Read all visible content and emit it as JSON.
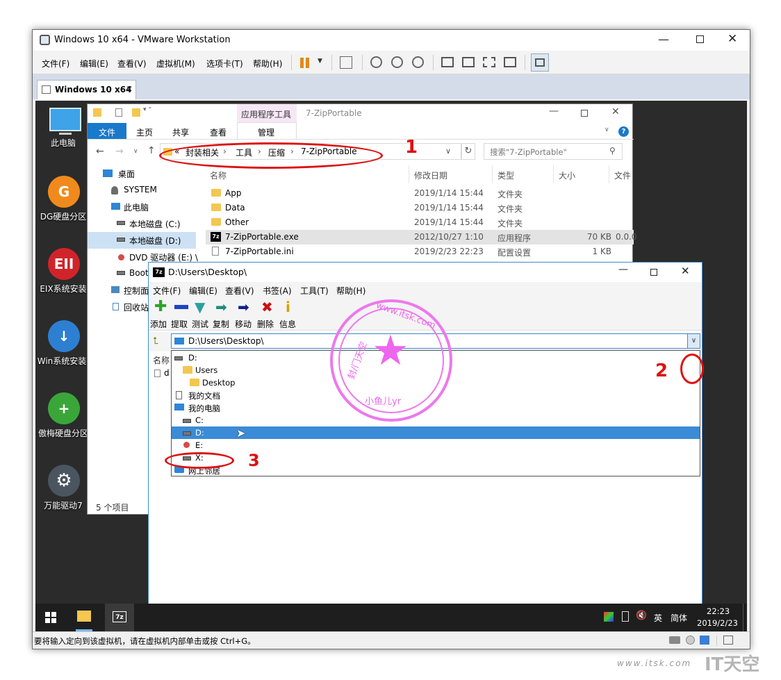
{
  "vmware": {
    "title": "Windows 10 x64 - VMware Workstation",
    "menu": [
      "文件(F)",
      "编辑(E)",
      "查看(V)",
      "虚拟机(M)",
      "选项卡(T)",
      "帮助(H)"
    ],
    "tab": "Windows 10 x64",
    "status_text": "要将输入定向到该虚拟机，请在虚拟机内部单击或按 Ctrl+G。"
  },
  "desktop": {
    "icons": [
      {
        "label": "此电脑",
        "icon": "monitor-icon"
      },
      {
        "label": "DG硬盘分区",
        "icon": "dg-icon"
      },
      {
        "label": "EIX系统安装",
        "icon": "eix-icon"
      },
      {
        "label": "Win系统安装",
        "icon": "win-install-icon"
      },
      {
        "label": "傲梅硬盘分区",
        "icon": "aomei-icon"
      },
      {
        "label": "万能驱动7",
        "icon": "gear-icon"
      }
    ]
  },
  "explorer": {
    "context_tab": "应用程序工具",
    "title": "7-ZipPortable",
    "ribbon_tabs": [
      "文件",
      "主页",
      "共享",
      "查看",
      "管理"
    ],
    "breadcrumb": {
      "prefix": "«",
      "parts": [
        "封装相关",
        "工具",
        "压缩",
        "7-ZipPortable"
      ]
    },
    "search_placeholder": "搜索\"7-ZipPortable\"",
    "nav": [
      "桌面",
      "SYSTEM",
      "此电脑",
      "本地磁盘 (C:)",
      "本地磁盘 (D:)",
      "DVD 驱动器 (E:) \\",
      "Boot",
      "控制面",
      "回收站"
    ],
    "columns": [
      "名称",
      "修改日期",
      "类型",
      "大小",
      "文件"
    ],
    "files": [
      {
        "name": "App",
        "date": "2019/1/14 15:44",
        "type": "文件夹",
        "size": "",
        "ver": ""
      },
      {
        "name": "Data",
        "date": "2019/1/14 15:44",
        "type": "文件夹",
        "size": "",
        "ver": ""
      },
      {
        "name": "Other",
        "date": "2019/1/14 15:44",
        "type": "文件夹",
        "size": "",
        "ver": ""
      },
      {
        "name": "7-ZipPortable.exe",
        "date": "2012/10/27 1:10",
        "type": "应用程序",
        "size": "70 KB",
        "ver": "0.0.0"
      },
      {
        "name": "7-ZipPortable.ini",
        "date": "2019/2/23 22:23",
        "type": "配置设置",
        "size": "1 KB",
        "ver": ""
      }
    ],
    "status": "5 个项目"
  },
  "zip": {
    "title": "D:\\Users\\Desktop\\",
    "menu": [
      "文件(F)",
      "编辑(E)",
      "查看(V)",
      "书签(A)",
      "工具(T)",
      "帮助(H)"
    ],
    "toolbar": [
      {
        "label": "添加",
        "icon": "plus-icon",
        "color": "#2aa52a"
      },
      {
        "label": "提取",
        "icon": "minus-icon",
        "color": "#1f45c7"
      },
      {
        "label": "测试",
        "icon": "check-icon",
        "color": "#2aa0a0"
      },
      {
        "label": "复制",
        "icon": "copy-arrow-icon",
        "color": "#1e8a7a"
      },
      {
        "label": "移动",
        "icon": "move-arrow-icon",
        "color": "#10208a"
      },
      {
        "label": "删除",
        "icon": "delete-x-icon",
        "color": "#cc1111"
      },
      {
        "label": "信息",
        "icon": "info-icon",
        "color": "#d4a000"
      }
    ],
    "address": "D:\\Users\\Desktop\\",
    "list_header": "名称",
    "list_item_partial": "d",
    "dropdown": [
      {
        "label": "D:",
        "indent": 0,
        "icon": "drive"
      },
      {
        "label": "Users",
        "indent": 1,
        "icon": "folder"
      },
      {
        "label": "Desktop",
        "indent": 2,
        "icon": "folder"
      },
      {
        "label": "我的文档",
        "indent": 0,
        "icon": "doc"
      },
      {
        "label": "我的电脑",
        "indent": 0,
        "icon": "computer"
      },
      {
        "label": "C:",
        "indent": 1,
        "icon": "drive"
      },
      {
        "label": "D:",
        "indent": 1,
        "icon": "drive",
        "selected": true
      },
      {
        "label": "E:",
        "indent": 1,
        "icon": "cd"
      },
      {
        "label": "X:",
        "indent": 1,
        "icon": "drive"
      },
      {
        "label": "网上邻居",
        "indent": 0,
        "icon": "network"
      }
    ]
  },
  "annotations": {
    "n1": "1",
    "n2": "2",
    "n3": "3",
    "color": "#dd1111"
  },
  "watermark": {
    "text": "www.itsk.com",
    "brand": "IT天空"
  },
  "stamp": {
    "top": "www.itsk.com",
    "left": "封/门天空",
    "bottom": "小鱼儿yr",
    "color": "#ee77ee"
  },
  "taskbar": {
    "ime1": "英",
    "ime2": "简体",
    "time": "22:23",
    "date": "2019/2/23"
  }
}
